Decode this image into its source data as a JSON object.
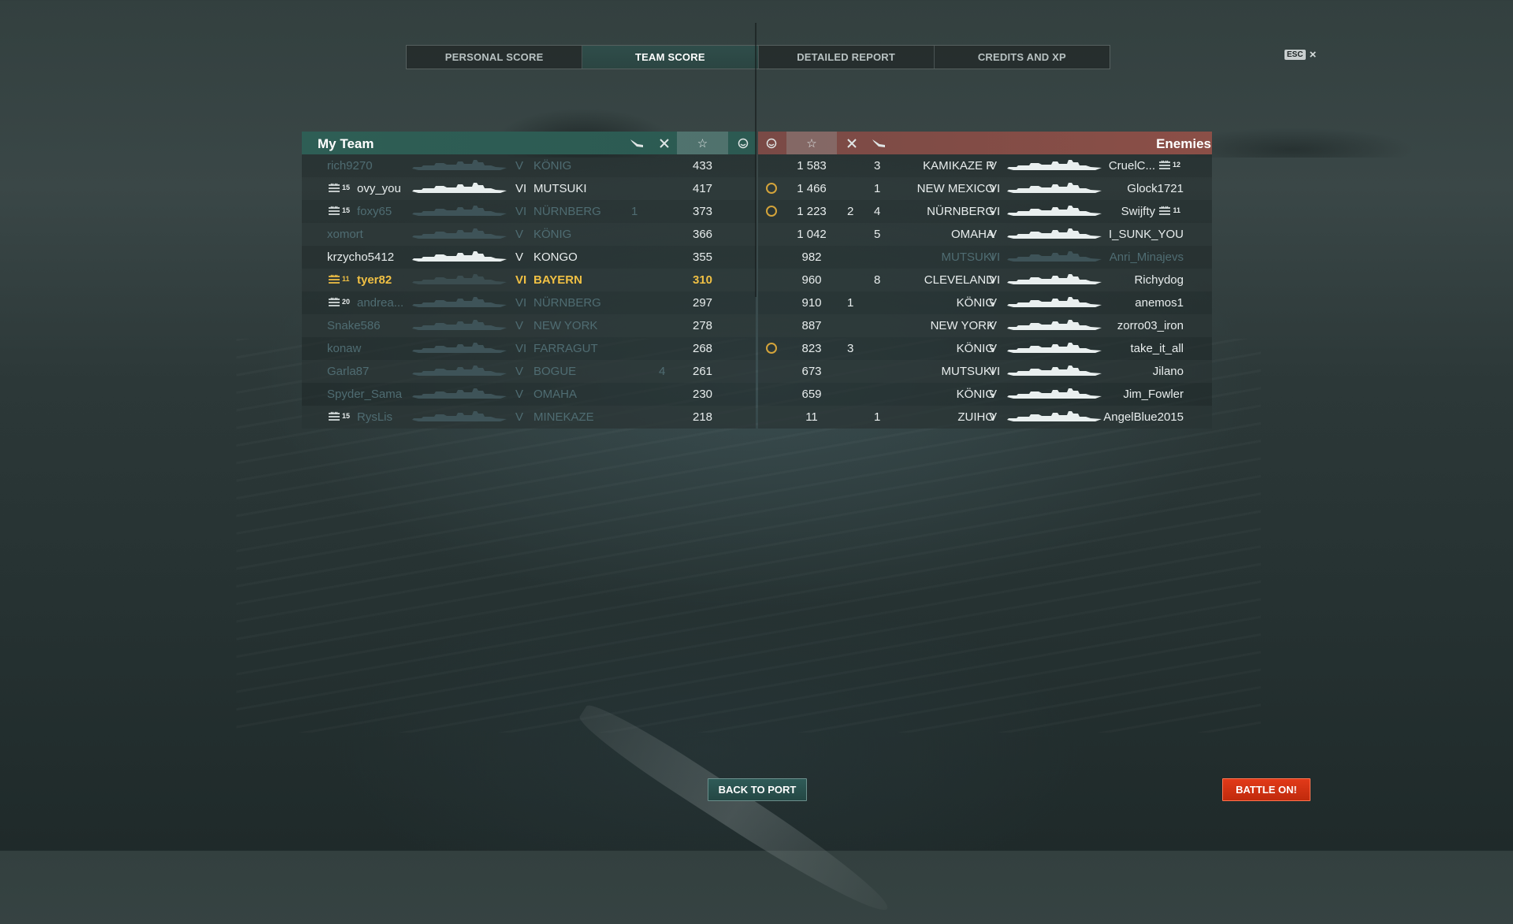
{
  "tabs": [
    {
      "label": "PERSONAL SCORE",
      "active": false
    },
    {
      "label": "TEAM SCORE",
      "active": true
    },
    {
      "label": "DETAILED REPORT",
      "active": false
    },
    {
      "label": "CREDITS AND XP",
      "active": false
    }
  ],
  "esc": {
    "key": "ESC",
    "close": "×"
  },
  "my_team": {
    "title": "My Team",
    "header_icons": [
      "plane-icon",
      "swords-icon",
      "star-icon",
      "survival-icon"
    ],
    "accent": "#2e5e55",
    "players": [
      {
        "name": "rich9270",
        "rank": "",
        "tier": "V",
        "ship": "KÖNIG",
        "planes": "",
        "kills": "",
        "score": "433",
        "style": "dim"
      },
      {
        "name": "ovy_you",
        "rank": "15",
        "tier": "VI",
        "ship": "MUTSUKI",
        "planes": "",
        "kills": "",
        "score": "417",
        "style": "bright"
      },
      {
        "name": "foxy65",
        "rank": "15",
        "tier": "VI",
        "ship": "NÜRNBERG",
        "planes": "1",
        "kills": "",
        "score": "373",
        "style": "dim"
      },
      {
        "name": "xomort",
        "rank": "",
        "tier": "V",
        "ship": "KÖNIG",
        "planes": "",
        "kills": "",
        "score": "366",
        "style": "dim"
      },
      {
        "name": "krzycho5412",
        "rank": "",
        "tier": "V",
        "ship": "KONGO",
        "planes": "",
        "kills": "",
        "score": "355",
        "style": "bright"
      },
      {
        "name": "tyer82",
        "rank": "11",
        "tier": "VI",
        "ship": "BAYERN",
        "planes": "",
        "kills": "",
        "score": "310",
        "style": "hl"
      },
      {
        "name": "andrea...",
        "rank": "20",
        "tier": "VI",
        "ship": "NÜRNBERG",
        "planes": "",
        "kills": "",
        "score": "297",
        "style": "dim"
      },
      {
        "name": "Snake586",
        "rank": "",
        "tier": "V",
        "ship": "NEW YORK",
        "planes": "",
        "kills": "",
        "score": "278",
        "style": "dim"
      },
      {
        "name": "konaw",
        "rank": "",
        "tier": "VI",
        "ship": "FARRAGUT",
        "planes": "",
        "kills": "",
        "score": "268",
        "style": "dim"
      },
      {
        "name": "Garla87",
        "rank": "",
        "tier": "V",
        "ship": "BOGUE",
        "planes": "",
        "kills": "4",
        "score": "261",
        "style": "dim"
      },
      {
        "name": "Spyder_Sama",
        "rank": "",
        "tier": "V",
        "ship": "OMAHA",
        "planes": "",
        "kills": "",
        "score": "230",
        "style": "dim"
      },
      {
        "name": "RysLis",
        "rank": "15",
        "tier": "V",
        "ship": "MINEKAZE",
        "planes": "",
        "kills": "",
        "score": "218",
        "style": "dim"
      }
    ]
  },
  "enemies": {
    "title": "Enemies",
    "header_icons": [
      "survival-icon",
      "star-icon",
      "swords-icon",
      "plane-icon"
    ],
    "accent": "#8b4f47",
    "players": [
      {
        "name": "CruelC...",
        "rank": "12",
        "tier": "V",
        "ship": "KAMIKAZE R",
        "planes": "",
        "kills": "3",
        "score": "1 583",
        "survived": false,
        "style": "bright"
      },
      {
        "name": "Glock1721",
        "rank": "",
        "tier": "VI",
        "ship": "NEW MEXICO",
        "planes": "",
        "kills": "1",
        "score": "1 466",
        "survived": true,
        "style": "bright"
      },
      {
        "name": "Swijfty",
        "rank": "11",
        "tier": "VI",
        "ship": "NÜRNBERG",
        "planes": "2",
        "kills": "4",
        "score": "1 223",
        "survived": true,
        "style": "bright"
      },
      {
        "name": "I_SUNK_YOU",
        "rank": "",
        "tier": "V",
        "ship": "OMAHA",
        "planes": "",
        "kills": "5",
        "score": "1 042",
        "survived": false,
        "style": "bright"
      },
      {
        "name": "Anri_Minajevs",
        "rank": "",
        "tier": "VI",
        "ship": "MUTSUKI",
        "planes": "",
        "kills": "",
        "score": "982",
        "survived": false,
        "style": "dim"
      },
      {
        "name": "Richydog",
        "rank": "",
        "tier": "VI",
        "ship": "CLEVELAND",
        "planes": "",
        "kills": "8",
        "score": "960",
        "survived": false,
        "style": "bright"
      },
      {
        "name": "anemos1",
        "rank": "",
        "tier": "V",
        "ship": "KÖNIG",
        "planes": "1",
        "kills": "",
        "score": "910",
        "survived": false,
        "style": "bright"
      },
      {
        "name": "zorro03_iron",
        "rank": "",
        "tier": "V",
        "ship": "NEW YORK",
        "planes": "",
        "kills": "",
        "score": "887",
        "survived": false,
        "style": "bright"
      },
      {
        "name": "take_it_all",
        "rank": "",
        "tier": "V",
        "ship": "KÖNIG",
        "planes": "3",
        "kills": "",
        "score": "823",
        "survived": true,
        "style": "bright"
      },
      {
        "name": "Jilano",
        "rank": "",
        "tier": "VI",
        "ship": "MUTSUKI",
        "planes": "",
        "kills": "",
        "score": "673",
        "survived": false,
        "style": "bright"
      },
      {
        "name": "Jim_Fowler",
        "rank": "",
        "tier": "V",
        "ship": "KÖNIG",
        "planes": "",
        "kills": "",
        "score": "659",
        "survived": false,
        "style": "bright"
      },
      {
        "name": "AngelBlue2015",
        "rank": "",
        "tier": "V",
        "ship": "ZUIHO",
        "planes": "",
        "kills": "1",
        "score": "11",
        "survived": false,
        "style": "bright"
      }
    ]
  },
  "buttons": {
    "back_to_port": "BACK TO PORT",
    "battle_on": "BATTLE ON!"
  },
  "colors": {
    "highlight": "#f0c044",
    "battle_button": "#d8300f",
    "port_button": "#2f5b58"
  }
}
